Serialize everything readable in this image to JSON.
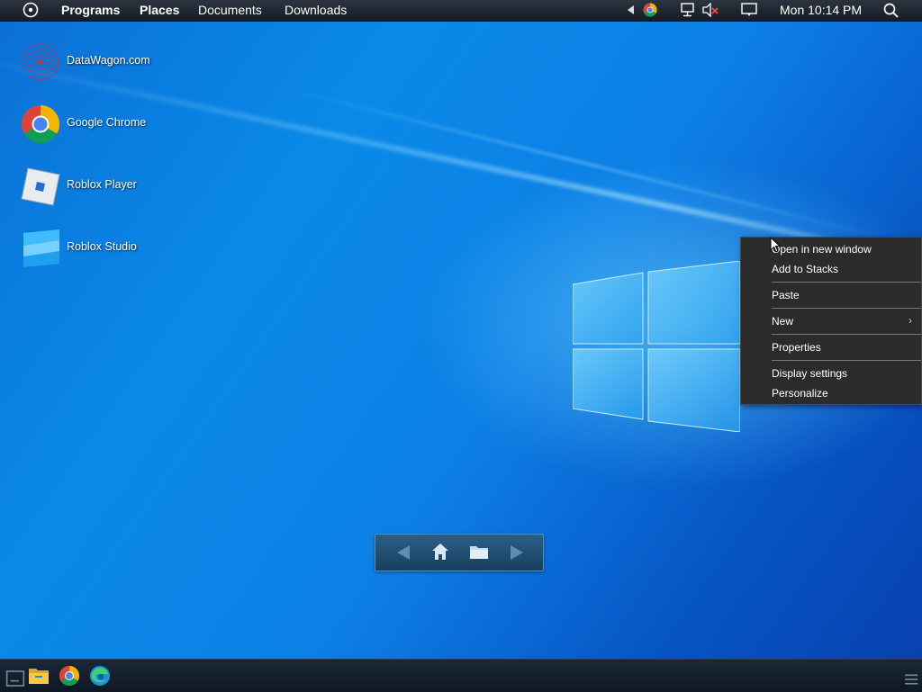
{
  "topbar": {
    "menu": [
      "Programs",
      "Places",
      "Documents",
      "Downloads"
    ],
    "clock": "Mon 10:14 PM"
  },
  "desktop_icons": [
    {
      "label": "DataWagon.com",
      "icon": "datawagon-icon"
    },
    {
      "label": "Google Chrome",
      "icon": "chrome-icon"
    },
    {
      "label": "Roblox Player",
      "icon": "roblox-player-icon"
    },
    {
      "label": "Roblox Studio",
      "icon": "roblox-studio-icon"
    }
  ],
  "context_menu": {
    "items": [
      "Open in new window",
      "Add to Stacks",
      "Paste",
      "New",
      "Properties",
      "Display settings",
      "Personalize"
    ]
  },
  "nav_widget": {
    "icons": [
      "back-arrow-icon",
      "home-icon",
      "folder-icon",
      "forward-arrow-icon"
    ]
  },
  "taskbar": {
    "icons": [
      "show-desktop-icon",
      "file-explorer-icon",
      "chrome-icon",
      "edge-icon",
      "menu-lines-icon"
    ]
  },
  "colors": {
    "desktop": "#0a84e6",
    "menu_bg": "#2b2b2b",
    "topbar": "#1e2630"
  }
}
